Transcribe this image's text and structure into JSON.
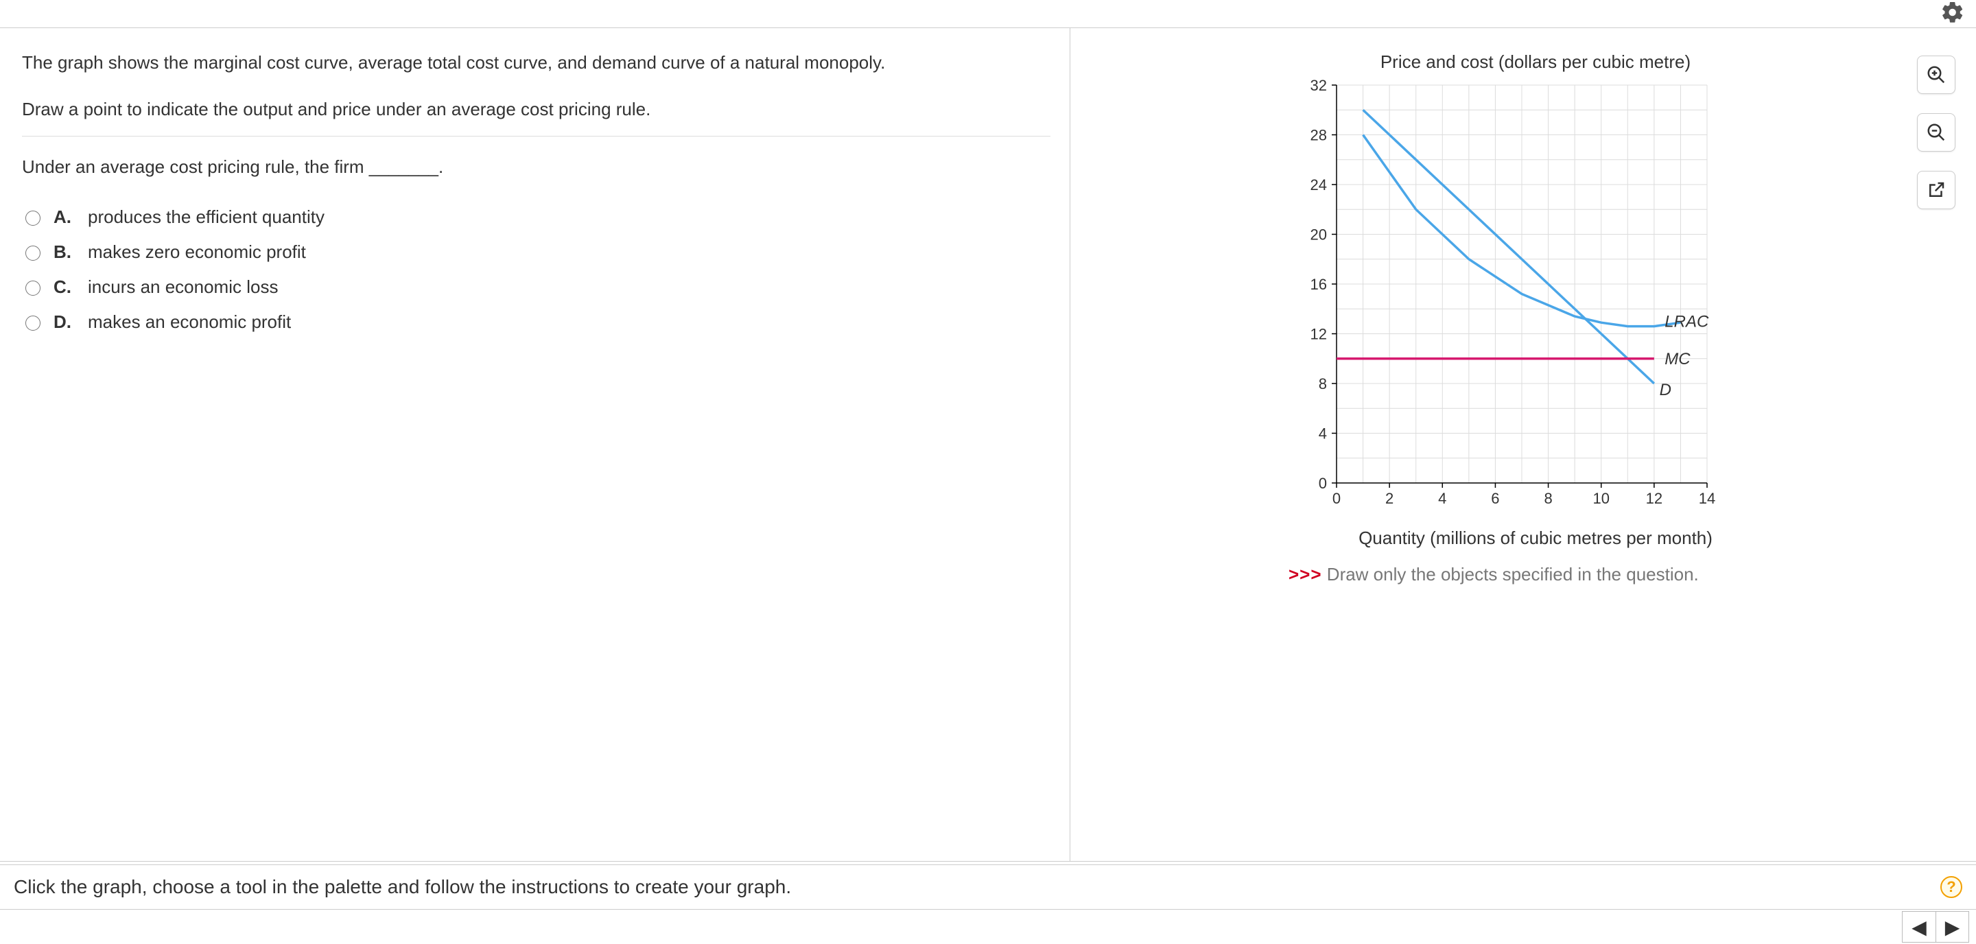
{
  "settings_icon": "gear",
  "prompt": {
    "line1": "The graph shows the marginal cost curve, average total cost curve, and demand curve of a natural monopoly.",
    "line2": "Draw a point to indicate the output and price under an average cost pricing rule.",
    "fill_in": "Under an average cost pricing rule, the firm _______."
  },
  "options": [
    {
      "letter": "A.",
      "text": "produces the efficient quantity"
    },
    {
      "letter": "B.",
      "text": "makes zero economic profit"
    },
    {
      "letter": "C.",
      "text": "incurs an economic loss"
    },
    {
      "letter": "D.",
      "text": "makes an economic profit"
    }
  ],
  "footer": {
    "instruction": "Click the graph, choose a tool in the palette and follow the instructions to create your graph.",
    "help_label": "?"
  },
  "nav": {
    "prev": "◀",
    "next": "▶"
  },
  "tools": {
    "zoom_in": "zoom-in",
    "zoom_out": "zoom-out",
    "popout": "open-in-new"
  },
  "hint": {
    "prefix": ">>>",
    "text": " Draw only the objects specified in the question."
  },
  "chart_data": {
    "type": "line",
    "title": "Price and cost (dollars per cubic metre)",
    "xlabel": "Quantity (millions of cubic metres per month)",
    "xlim": [
      0,
      14
    ],
    "ylim": [
      0,
      32
    ],
    "xticks": [
      0,
      2,
      4,
      6,
      8,
      10,
      12,
      14
    ],
    "yticks": [
      0,
      4,
      8,
      12,
      16,
      20,
      24,
      28,
      32
    ],
    "grid": true,
    "series": [
      {
        "name": "D",
        "color": "#4aa6e8",
        "x": [
          1,
          12
        ],
        "y": [
          30,
          8
        ]
      },
      {
        "name": "LRAC",
        "color": "#4aa6e8",
        "x": [
          1,
          3,
          5,
          7,
          9,
          10,
          11,
          12,
          13
        ],
        "y": [
          28,
          22,
          18,
          15.2,
          13.4,
          12.9,
          12.6,
          12.6,
          12.9
        ]
      },
      {
        "name": "MC",
        "color": "#d61a6f",
        "x": [
          0,
          12
        ],
        "y": [
          10,
          10
        ]
      }
    ],
    "labels": [
      {
        "text": "LRAC",
        "x": 12.4,
        "y": 13,
        "italic": true
      },
      {
        "text": "MC",
        "x": 12.4,
        "y": 10,
        "italic": true
      },
      {
        "text": "D",
        "x": 12.2,
        "y": 7.5,
        "italic": true
      }
    ]
  }
}
